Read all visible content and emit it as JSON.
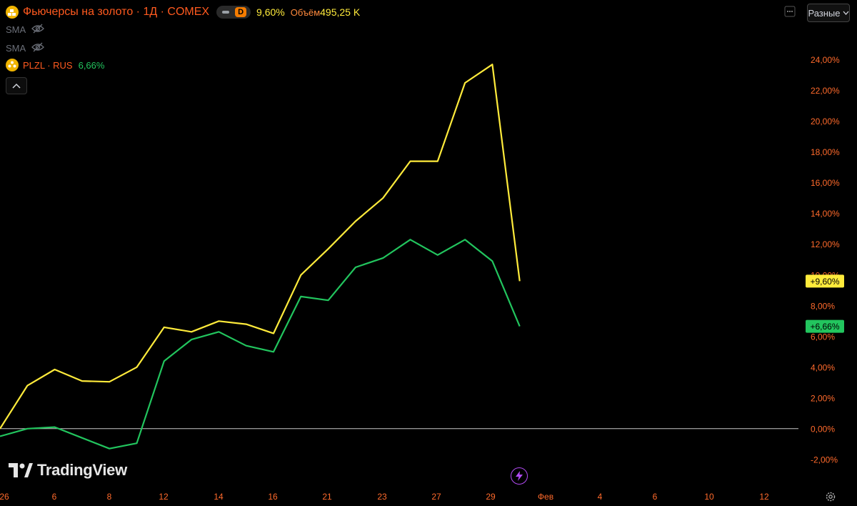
{
  "header": {
    "title": "Фьючерсы на золото · 1Д · COMEX",
    "interval_badge": "D",
    "last_change": "9,60%",
    "volume_label": "Объём",
    "volume_value": "495,25 K"
  },
  "indicators": [
    {
      "name": "SMA",
      "icon": "eye-off-icon"
    },
    {
      "name": "SMA",
      "icon": "eye-off-icon"
    }
  ],
  "compare": {
    "symbol": "PLZL · RUS",
    "change": "6,66%"
  },
  "scale_button": {
    "label": "Разные"
  },
  "logo": {
    "text": "TradingView"
  },
  "colors": {
    "gold": "#ffeb3b",
    "plzl": "#22c55e",
    "axis_text": "#ff6a2b",
    "baseline": "#c8c8c8",
    "background": "#000000"
  },
  "chart_data": {
    "type": "line",
    "x_ticks": [
      "26",
      "6",
      "8",
      "12",
      "14",
      "16",
      "21",
      "23",
      "27",
      "29",
      "Фев",
      "4",
      "6",
      "10",
      "12"
    ],
    "ylim": [
      -2.8,
      25.8
    ],
    "y_ticks": [
      -2,
      0,
      2,
      4,
      6,
      8,
      10,
      12,
      14,
      16,
      18,
      20,
      22,
      24
    ],
    "y_tick_labels": [
      "-2,00%",
      "0,00%",
      "2,00%",
      "4,00%",
      "6,00%",
      "8,00%",
      "10,00%",
      "12,00%",
      "14,00%",
      "16,00%",
      "18,00%",
      "20,00%",
      "22,00%",
      "24,00%"
    ],
    "baseline": 0,
    "series": [
      {
        "name": "Фьючерсы на золото",
        "color": "#ffeb3b",
        "last_label": "+9,60%",
        "values": [
          0.0,
          2.8,
          3.85,
          3.1,
          3.05,
          4.0,
          6.6,
          6.3,
          7.0,
          6.8,
          6.2,
          10.0,
          11.7,
          13.5,
          15.0,
          17.4,
          17.4,
          22.5,
          23.7,
          9.6
        ]
      },
      {
        "name": "PLZL · RUS",
        "color": "#22c55e",
        "last_label": "+6,66%",
        "values": [
          -0.5,
          0.0,
          0.1,
          -0.6,
          -1.3,
          -0.95,
          4.4,
          5.8,
          6.3,
          5.4,
          5.0,
          8.6,
          8.35,
          10.5,
          11.1,
          12.3,
          11.3,
          12.3,
          10.9,
          6.66
        ]
      }
    ]
  }
}
